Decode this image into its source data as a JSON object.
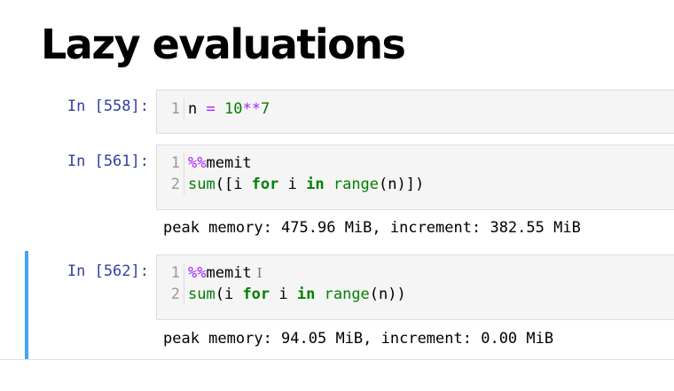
{
  "title": "Lazy evaluations",
  "cells": [
    {
      "prompt": "In [558]:",
      "lines": [
        {
          "no": "1",
          "tokens": [
            {
              "t": "n ",
              "c": "plain"
            },
            {
              "t": "=",
              "c": "op"
            },
            {
              "t": " ",
              "c": "plain"
            },
            {
              "t": "10",
              "c": "num"
            },
            {
              "t": "**",
              "c": "op"
            },
            {
              "t": "7",
              "c": "num"
            }
          ]
        }
      ]
    },
    {
      "prompt": "In [561]:",
      "lines": [
        {
          "no": "1",
          "tokens": [
            {
              "t": "%%",
              "c": "magic"
            },
            {
              "t": "memit",
              "c": "plain"
            }
          ]
        },
        {
          "no": "2",
          "tokens": [
            {
              "t": "sum",
              "c": "bi"
            },
            {
              "t": "([i ",
              "c": "plain"
            },
            {
              "t": "for",
              "c": "kw"
            },
            {
              "t": " i ",
              "c": "plain"
            },
            {
              "t": "in",
              "c": "kw"
            },
            {
              "t": " ",
              "c": "plain"
            },
            {
              "t": "range",
              "c": "bi"
            },
            {
              "t": "(n)])",
              "c": "plain"
            }
          ]
        }
      ],
      "output": "peak memory: 475.96 MiB, increment: 382.55 MiB"
    },
    {
      "prompt": "In [562]:",
      "selected": true,
      "lines": [
        {
          "no": "1",
          "tokens": [
            {
              "t": "%%",
              "c": "magic"
            },
            {
              "t": "memit",
              "c": "plain"
            }
          ]
        },
        {
          "no": "2",
          "tokens": [
            {
              "t": "sum",
              "c": "bi"
            },
            {
              "t": "(i ",
              "c": "plain"
            },
            {
              "t": "for",
              "c": "kw"
            },
            {
              "t": " i ",
              "c": "plain"
            },
            {
              "t": "in",
              "c": "kw"
            },
            {
              "t": " ",
              "c": "plain"
            },
            {
              "t": "range",
              "c": "bi"
            },
            {
              "t": "(n))",
              "c": "plain"
            }
          ]
        }
      ],
      "output": "peak memory: 94.05 MiB, increment: 0.00 MiB"
    }
  ],
  "colors": {
    "prompt": "#303f9f",
    "selection_bar": "#42a5f5",
    "keyword": "#008000",
    "operator": "#aa22ff"
  },
  "icons": {
    "text_cursor": "text-cursor-icon"
  }
}
